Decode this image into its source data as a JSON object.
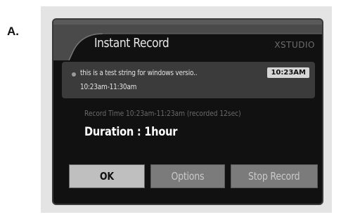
{
  "figure_label": "A.",
  "dialog": {
    "title": "Instant Record",
    "brand": "XSTUDIO",
    "program": {
      "title": "this is a test string for windows versio..",
      "time_range": "10:23am-11:30am",
      "clock": "10:23AM"
    },
    "record_time": "Record Time 10:23am-11:23am (recorded 12sec)",
    "duration": "Duration : 1hour",
    "buttons": {
      "ok": "OK",
      "options": "Options",
      "stop_record": "Stop Record"
    }
  },
  "colors": {
    "dialog_background": "#111111",
    "selected_button": "#bfbfbf",
    "button": "#7b7b7b",
    "program_panel": "#3b3b3b"
  }
}
